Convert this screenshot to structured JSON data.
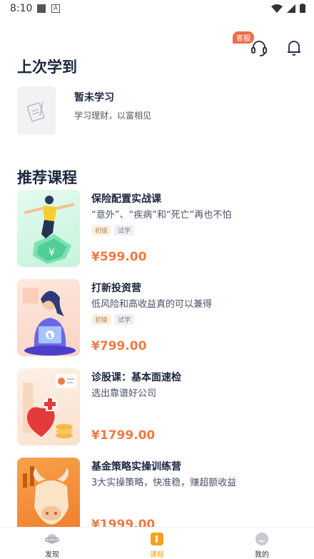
{
  "status_bar": {
    "time": "8:10"
  },
  "header": {
    "kefu_badge": "客服"
  },
  "last_learned": {
    "title": "上次学到",
    "item_title": "暂未学习",
    "item_subtitle": "学习理财，以富相见"
  },
  "recommended": {
    "title": "推荐课程",
    "courses": [
      {
        "title": "保险配置实战课",
        "desc": "“意外”、“疾病”和“死亡”再也不怕",
        "tags": [
          "初级",
          "试学"
        ],
        "price": "¥599.00"
      },
      {
        "title": "打新投资营",
        "desc": "低风险和高收益真的可以兼得",
        "tags": [
          "初级",
          "试学"
        ],
        "price": "¥799.00"
      },
      {
        "title": "诊股课：基本面速检",
        "desc": "选出靠谱好公司",
        "tags": [],
        "price": "¥1799.00"
      },
      {
        "title": "基金策略实操训练营",
        "desc": "3大实操策略，快准稳，赚超额收益",
        "tags": [],
        "price": "¥1999.00"
      }
    ]
  },
  "tabbar": {
    "items": [
      {
        "label": "发现"
      },
      {
        "label": "课程"
      },
      {
        "label": "我的"
      }
    ],
    "active": "课程",
    "accent": "#f3a21a"
  },
  "colors": {
    "price": "#f07a44",
    "title": "#1c2640",
    "badge": "#f26b4b"
  }
}
